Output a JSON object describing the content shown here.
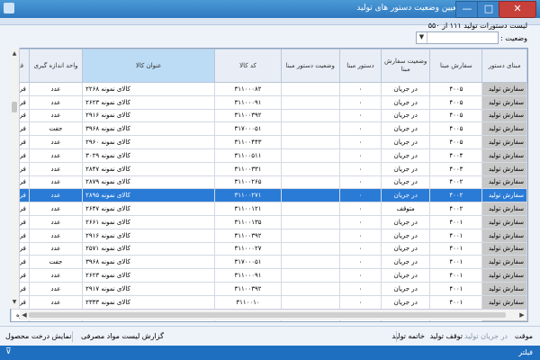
{
  "window": {
    "title": "تعیین وضعیت دستور های تولید",
    "minimize": "—",
    "maximize": "□",
    "close": "✕"
  },
  "info_text": "لیست دستورات تولید ۱۱۱ از ۵۵۰",
  "status_filter": {
    "label": "وضعیت :",
    "value": "",
    "arrow": "▼"
  },
  "columns": [
    "مبنای دستور",
    "سفارش مبنا",
    "وضعیت سفارش مبنا",
    "دستور مبنا",
    "وضعیت دستور مبنا",
    "کد کالا",
    "عنوان کالا",
    "واحد اندازه گیری",
    "فر"
  ],
  "rows": [
    [
      "سفارش تولید",
      "۴۰۰۵",
      "در جریان",
      "۰",
      "",
      "۳۱۱۰۰۰۸۲",
      "کالای نمونه ۲۲۶۸",
      "عدد",
      "فره"
    ],
    [
      "سفارش تولید",
      "۴۰۰۵",
      "در جریان",
      "۰",
      "",
      "۳۱۱۰۰۰۹۱",
      "کالای نمونه ۲۶۲۳",
      "عدد",
      "فره"
    ],
    [
      "سفارش تولید",
      "۴۰۰۵",
      "در جریان",
      "۰",
      "",
      "۳۱۱۰۰۳۹۲",
      "کالای نمونه ۲۹۱۶",
      "عدد",
      "فره"
    ],
    [
      "سفارش تولید",
      "۴۰۰۵",
      "در جریان",
      "۰",
      "",
      "۳۱۷۰۰۰۵۱",
      "کالای نمونه ۳۹۶۸",
      "جفت",
      "فره"
    ],
    [
      "سفارش تولید",
      "۴۰۰۵",
      "در جریان",
      "۰",
      "",
      "۳۱۱۰۰۴۴۳",
      "کالای نمونه ۲۹۶۰",
      "عدد",
      "فره"
    ],
    [
      "سفارش تولید",
      "۴۰۰۴",
      "در جریان",
      "۰",
      "",
      "۳۱۱۰۰۵۱۱",
      "کالای نمونه ۳۰۲۹",
      "عدد",
      "فره"
    ],
    [
      "سفارش تولید",
      "۴۰۰۳",
      "در جریان",
      "۰",
      "",
      "۳۱۱۰۰۳۳۱",
      "کالای نمونه ۲۸۴۷",
      "عدد",
      "فره"
    ],
    [
      "سفارش تولید",
      "۴۰۰۲",
      "در جریان",
      "۰",
      "",
      "۳۱۱۰۰۲۶۵",
      "کالای نمونه ۲۸۷۹",
      "عدد",
      "فره"
    ],
    [
      "سفارش تولید",
      "۴۰۰۲",
      "در جریان",
      "۰",
      "",
      "۳۱۱۰۰۲۷۱",
      "کالای نمونه ۲۸۹۵",
      "عدد",
      "فره"
    ],
    [
      "سفارش تولید",
      "۴۰۰۲",
      "متوقف",
      "۰",
      "",
      "۳۱۱۰۰۱۲۱",
      "کالای نمونه ۲۶۴۷",
      "عدد",
      "فره"
    ],
    [
      "سفارش تولید",
      "۴۰۰۱",
      "در جریان",
      "۰",
      "",
      "۳۱۱۰۰۱۳۵",
      "کالای نمونه ۲۶۶۱",
      "عدد",
      "فره"
    ],
    [
      "سفارش تولید",
      "۴۰۰۱",
      "در جریان",
      "۰",
      "",
      "۳۱۱۰۰۳۹۲",
      "کالای نمونه ۲۹۱۶",
      "عدد",
      "فره"
    ],
    [
      "سفارش تولید",
      "۴۰۰۱",
      "در جریان",
      "۰",
      "",
      "۳۱۱۰۰۰۲۷",
      "کالای نمونه ۲۵۷۱",
      "عدد",
      "فره"
    ],
    [
      "سفارش تولید",
      "۴۰۰۱",
      "در جریان",
      "۰",
      "",
      "۳۱۷۰۰۰۵۱",
      "کالای نمونه ۳۹۶۸",
      "جفت",
      "فره"
    ],
    [
      "سفارش تولید",
      "۴۰۰۱",
      "در جریان",
      "۰",
      "",
      "۳۱۱۰۰۰۹۱",
      "کالای نمونه ۲۶۲۳",
      "عدد",
      "فره"
    ],
    [
      "سفارش تولید",
      "۴۰۰۱",
      "در جریان",
      "۰",
      "",
      "۳۱۱۰۰۳۹۲",
      "کالای نمونه ۲۹۱۷",
      "عدد",
      "فره"
    ],
    [
      "سفارش تولید",
      "۴۰۰۱",
      "در جریان",
      "۰",
      "",
      "۳۱۱۰۰۱۰",
      "کالای نمونه ۲۳۳۳",
      "عدد",
      "فره"
    ],
    [
      "سفارش تولید",
      "۴۰۰۱",
      "در جریان",
      "۰",
      "",
      "۳۱۱۰۰۱۳۲",
      "کالای نمونه ۲۵۵۸",
      "عدد",
      "فره"
    ]
  ],
  "selected_row": 8,
  "bottom_actions": {
    "title": "موقت",
    "in_progress": "در جریان تولید",
    "stop": "توقف تولید",
    "finish": "خاتمه تولید",
    "report": "گزارش لیست مواد مصرفی",
    "tree": "نمایش درخت محصول"
  },
  "statusbar": {
    "filter": "فیلتر",
    "icon": "funnel-icon"
  },
  "colors": {
    "title_bar": "#2f78bf",
    "selected_row": "#2a7bd6",
    "status_bar": "#1f6fc1"
  }
}
